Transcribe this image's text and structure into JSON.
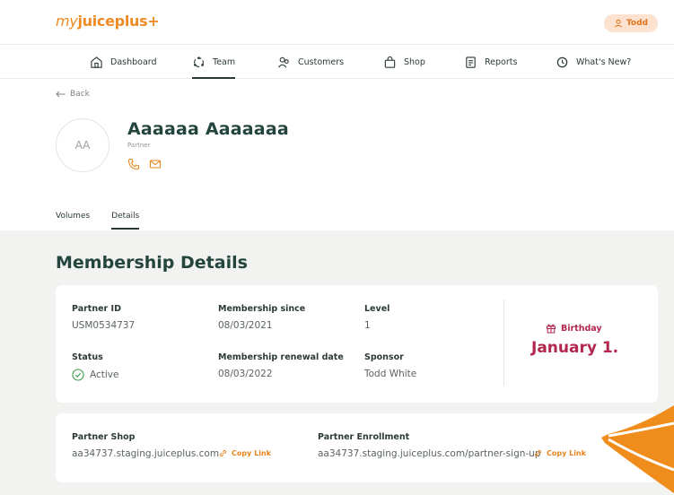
{
  "header": {
    "logo_prefix": "my",
    "logo_main": "juiceplus+",
    "user_name": "Todd"
  },
  "nav": {
    "items": [
      {
        "label": "Dashboard",
        "icon": "home-icon"
      },
      {
        "label": "Team",
        "icon": "team-icon",
        "active": true
      },
      {
        "label": "Customers",
        "icon": "customers-icon"
      },
      {
        "label": "Shop",
        "icon": "shopping-bag-icon"
      },
      {
        "label": "Reports",
        "icon": "reports-icon"
      },
      {
        "label": "What's New?",
        "icon": "clock-icon"
      }
    ]
  },
  "back_label": "Back",
  "member": {
    "initials": "AA",
    "name": "Aaaaaa Aaaaaaa",
    "role": "Partner"
  },
  "subtabs": [
    {
      "label": "Volumes"
    },
    {
      "label": "Details",
      "active": true
    }
  ],
  "section_title": "Membership Details",
  "details": {
    "partner_id_label": "Partner ID",
    "partner_id": "USM0534737",
    "membership_since_label": "Membership since",
    "membership_since": "08/03/2021",
    "level_label": "Level",
    "level": "1",
    "status_label": "Status",
    "status": "Active",
    "renewal_label": "Membership renewal date",
    "renewal": "08/03/2022",
    "sponsor_label": "Sponsor",
    "sponsor": "Todd White",
    "birthday_label": "Birthday",
    "birthday": "January 1."
  },
  "links": {
    "shop_label": "Partner Shop",
    "shop_url": "aa34737.staging.juiceplus.com",
    "enrollment_label": "Partner Enrollment",
    "enrollment_url": "aa34737.staging.juiceplus.com/partner-sign-up",
    "copy_label": "Copy Link"
  },
  "colors": {
    "accent_orange": "#f08a24",
    "heading_green": "#23453d",
    "birthday_red": "#b3264e",
    "active_green": "#3a9a4a"
  }
}
